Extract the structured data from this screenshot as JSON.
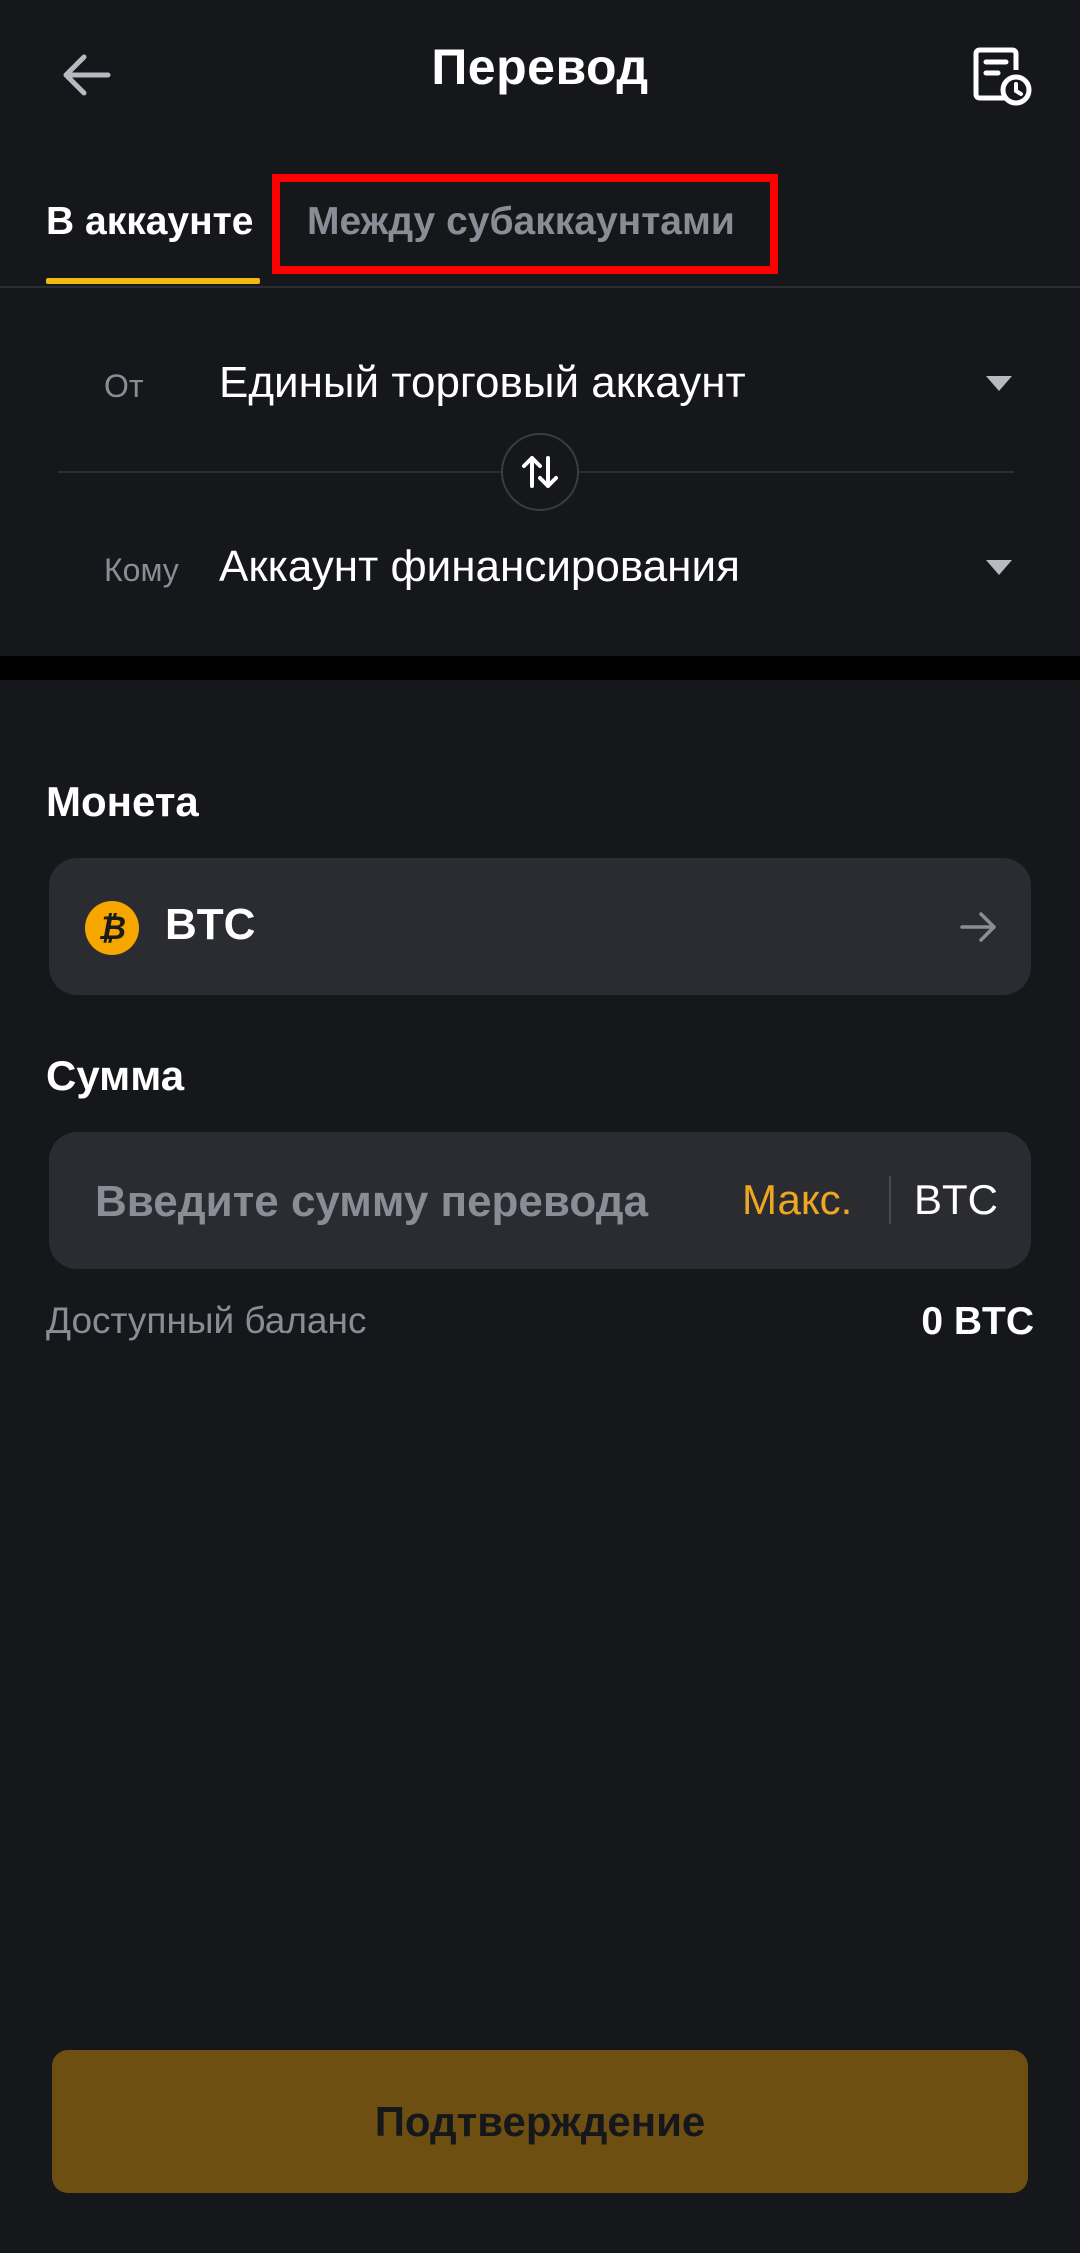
{
  "header": {
    "title": "Перевод",
    "back_icon": "arrow-left-icon",
    "history_icon": "history-document-icon"
  },
  "tabs": [
    {
      "label": "В аккаунте",
      "active": true
    },
    {
      "label": "Между субаккаунтами",
      "active": false,
      "highlighted": true
    }
  ],
  "accounts": {
    "from_label": "От",
    "from_value": "Единый торговый аккаунт",
    "to_label": "Кому",
    "to_value": "Аккаунт финансирования",
    "swap_icon": "swap-vertical-icon"
  },
  "coin": {
    "label": "Монета",
    "symbol": "BTC",
    "icon_glyph": "₿",
    "icon_color": "#f7a600"
  },
  "amount": {
    "label": "Сумма",
    "placeholder": "Введите сумму перевода",
    "max_label": "Макс.",
    "unit": "BTC"
  },
  "balance": {
    "label": "Доступный баланс",
    "value": "0 BTC"
  },
  "confirm_label": "Подтверждение",
  "colors": {
    "background": "#16171b",
    "accent": "#f0b90b",
    "max_text": "#f0a620",
    "confirm_button": "#6e4f12",
    "highlight_box": "#ff0000"
  }
}
